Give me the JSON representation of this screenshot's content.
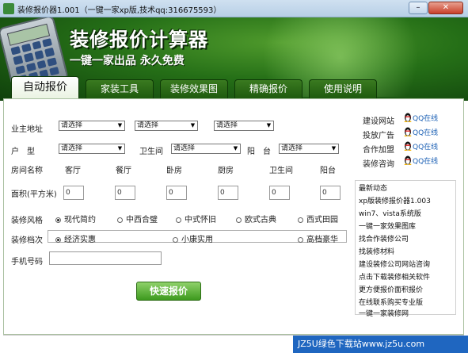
{
  "window": {
    "title": "装修报价器1.001（一键一家xp版,技术qq:316675593）",
    "minimize_label": "–",
    "close_label": "✕"
  },
  "banner": {
    "headline": "装修报价计算器",
    "slogan": "一键一家出品 永久免费"
  },
  "tabs": [
    {
      "label": "自动报价",
      "active": true
    },
    {
      "label": "家装工具",
      "active": false
    },
    {
      "label": "装修效果图",
      "active": false
    },
    {
      "label": "精确报价",
      "active": false
    },
    {
      "label": "使用说明",
      "active": false
    }
  ],
  "form": {
    "address_label": "业主地址",
    "address_selects": [
      "请选择",
      "请选择",
      "请选择"
    ],
    "layout_label": "户　型",
    "bathroom_label": "卫生间",
    "balcony_label": "阳　台",
    "layout_selects": [
      "请选择",
      "请选择",
      "请选择"
    ],
    "room_name_label": "房间名称",
    "rooms": [
      "客厅",
      "餐厅",
      "卧房",
      "厨房",
      "卫生间",
      "阳台"
    ],
    "area_label": "面积(平方米)",
    "areas": [
      "0",
      "0",
      "0",
      "0",
      "0",
      "0"
    ],
    "style_label": "装修风格",
    "styles": [
      {
        "label": "现代简约",
        "selected": true
      },
      {
        "label": "中西合璧",
        "selected": false
      },
      {
        "label": "中式怀旧",
        "selected": false
      },
      {
        "label": "欧式古典",
        "selected": false
      },
      {
        "label": "西式田园",
        "selected": false
      }
    ],
    "grade_label": "装修档次",
    "grades": [
      {
        "label": "经济实惠",
        "selected": true
      },
      {
        "label": "小康实用",
        "selected": false
      },
      {
        "label": "高档豪华",
        "selected": false
      }
    ],
    "phone_label": "手机号码",
    "phone_value": "",
    "quote_button": "快速报价"
  },
  "sidebar": {
    "links": [
      {
        "label": "建设网站",
        "qq": "QQ在线"
      },
      {
        "label": "投放广告",
        "qq": "QQ在线"
      },
      {
        "label": "合作加盟",
        "qq": "QQ在线"
      },
      {
        "label": "装修咨询",
        "qq": "QQ在线"
      }
    ],
    "news_title": "最新动态",
    "news": [
      "xp版装修报价器1.003",
      "win7、vista系统版",
      "一键一家效果图库",
      "找合作装修公司",
      "找装修材料",
      "建设装修公司网站咨询",
      "点击下载装修相关软件",
      "更方便报价面积报价",
      "在线联系购买专业版",
      "一键一家装修网"
    ]
  },
  "watermark": "JZ5U绿色下载站www.jz5u.com"
}
